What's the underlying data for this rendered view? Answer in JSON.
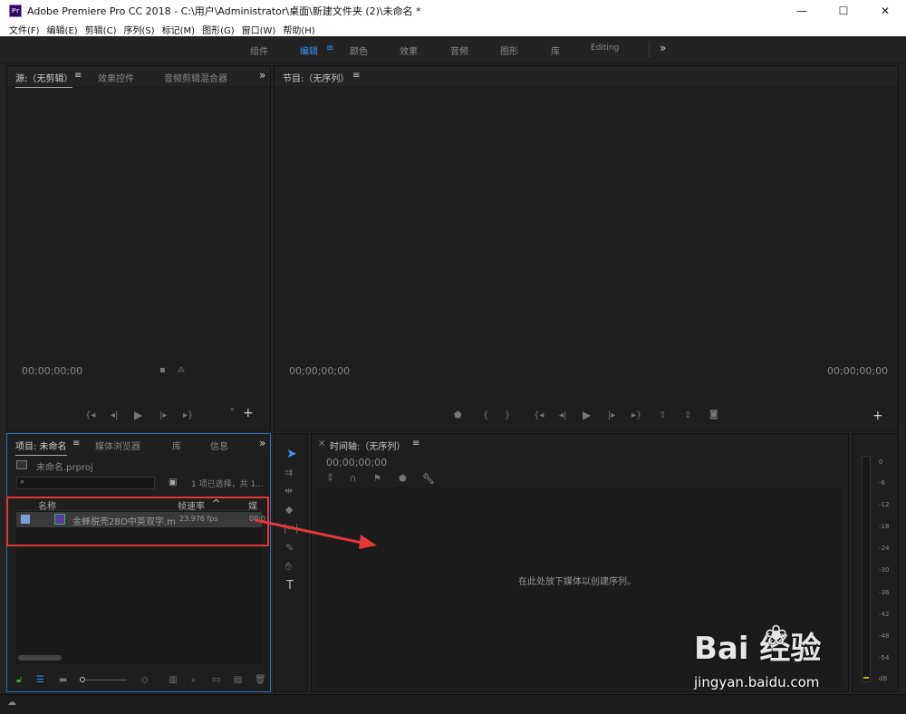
{
  "window": {
    "title": "Adobe Premiere Pro CC 2018 - C:\\用户\\Administrator\\桌面\\新建文件夹 (2)\\未命名 *",
    "app_icon_text": "Pr",
    "minimize": "—",
    "maximize": "☐",
    "close": "✕"
  },
  "menu": [
    "文件(F)",
    "编辑(E)",
    "剪辑(C)",
    "序列(S)",
    "标记(M)",
    "图形(G)",
    "窗口(W)",
    "帮助(H)"
  ],
  "workspaces": {
    "items": [
      "组件",
      "编辑",
      "颜色",
      "效果",
      "音频",
      "图形",
      "库",
      "Editing"
    ],
    "active": "编辑",
    "more": "»",
    "active_menu": "≡"
  },
  "source_panel": {
    "tabs": [
      "源:（无剪辑）",
      "效果控件",
      "音频剪辑混合器"
    ],
    "tab_menu": "≡",
    "more": "»",
    "timecode": "00;00;00;00",
    "add": "+"
  },
  "program_panel": {
    "title": "节目:（无序列）",
    "tab_menu": "≡",
    "timecode_left": "00;00;00;00",
    "timecode_right": "00;00;00;00",
    "add": "+"
  },
  "project_panel": {
    "tabs": [
      "项目: 未命名",
      "媒体浏览器",
      "库",
      "信息"
    ],
    "tab_menu": "≡",
    "more": "»",
    "project_file": "未命名.prproj",
    "selection_info": "1 项已选择，共 1...",
    "columns": [
      "名称",
      "帧速率",
      "媒体"
    ],
    "sort_indicator": "^",
    "items": [
      {
        "name": "金蝉脱壳2BD中英双字.m",
        "fps": "23.976 fps",
        "media": "00:0"
      }
    ]
  },
  "timeline_panel": {
    "close": "×",
    "title": "时间轴:（无序列）",
    "tab_menu": "≡",
    "timecode": "00;00;00;00",
    "hint": "在此处放下媒体以创建序列。"
  },
  "audio_meter": {
    "labels": [
      "0",
      "-6",
      "-12",
      "-18",
      "-24",
      "-30",
      "-36",
      "-42",
      "-48",
      "-54",
      "dB"
    ]
  },
  "watermark": {
    "brand": "Bai  经验",
    "url": "jingyan.baidu.com"
  },
  "colors": {
    "accent": "#3a95f0",
    "highlight": "#e0383b"
  }
}
